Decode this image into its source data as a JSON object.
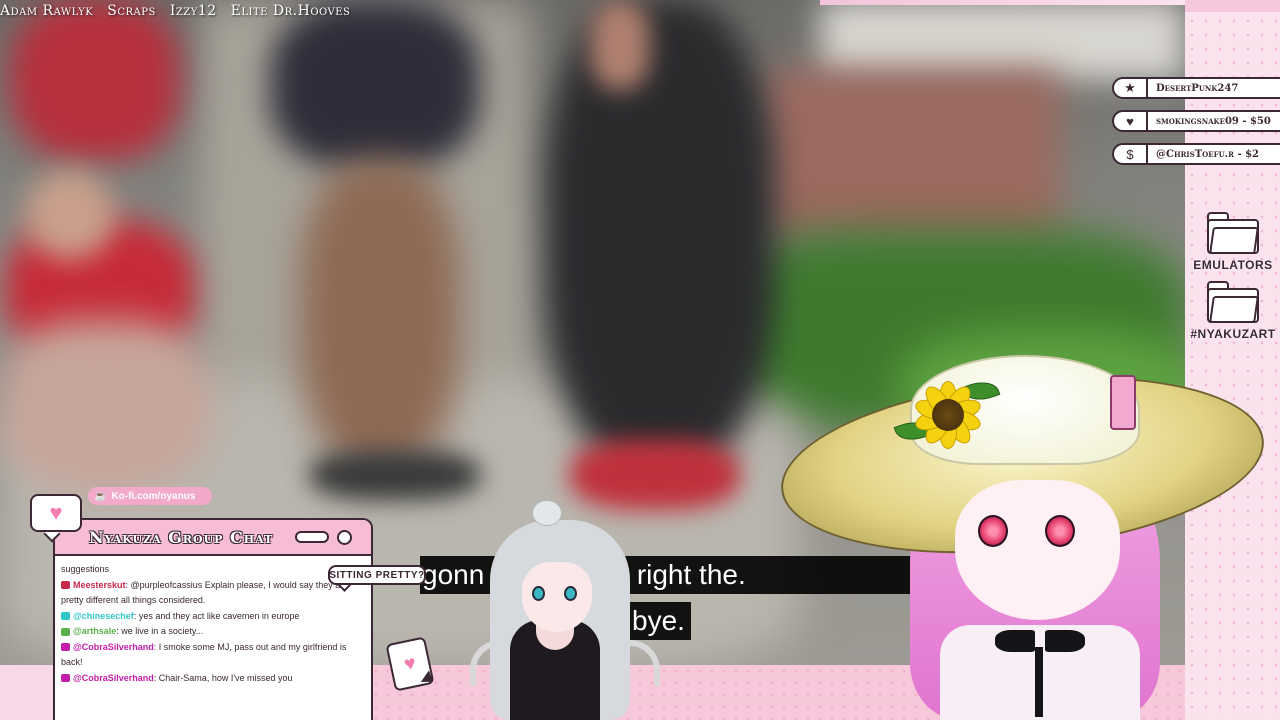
{
  "credits": [
    "Adam Rawlyk",
    "Scraps",
    "Izzy12",
    "Elite Dr.Hooves"
  ],
  "alerts": [
    {
      "icon": "star-icon",
      "glyph": "★",
      "text": "DesertPunk247"
    },
    {
      "icon": "heart-icon",
      "glyph": "♥",
      "text": "smokingsnake09 - $50"
    },
    {
      "icon": "dollar-icon",
      "glyph": "$",
      "text": "@ChrisToefu.r - $2"
    }
  ],
  "folders": [
    {
      "label": "EMULATORS"
    },
    {
      "label": "#NYAKUZART"
    }
  ],
  "subtitles": {
    "line1": "gonn        down right, right the.",
    "line2": "bye."
  },
  "kofi": {
    "text": "Ko-fi.com/nyanus"
  },
  "chat": {
    "title": "Nyakuza Group Chat",
    "messages": [
      {
        "user": "",
        "text": "suggestions",
        "color": ""
      },
      {
        "user": "Meesterskut",
        "text": ": @purpleofcassius Explain please, I would say they are pretty different all things considered.",
        "color": "#c62a4a"
      },
      {
        "user": "@chinesechef",
        "text": ": yes and they act like cavemen in europe",
        "color": "#2fc7c7"
      },
      {
        "user": "@arthsale",
        "text": ": we live in a society...",
        "color": "#5ab04a"
      },
      {
        "user": "@CobraSilverhand",
        "text": ": I smoke some MJ, pass out and my girlfriend is back!",
        "color": "#c21ea8"
      },
      {
        "user": "@CobraSilverhand",
        "text": ": Chair-Sama, how I've missed you",
        "color": "#c21ea8"
      }
    ]
  },
  "bubble": {
    "text": "SITTING PRETTY?"
  },
  "colors": {
    "accent_pink": "#f7bcd6",
    "outline": "#3b2834",
    "sidebar": "#fbe3ee"
  }
}
